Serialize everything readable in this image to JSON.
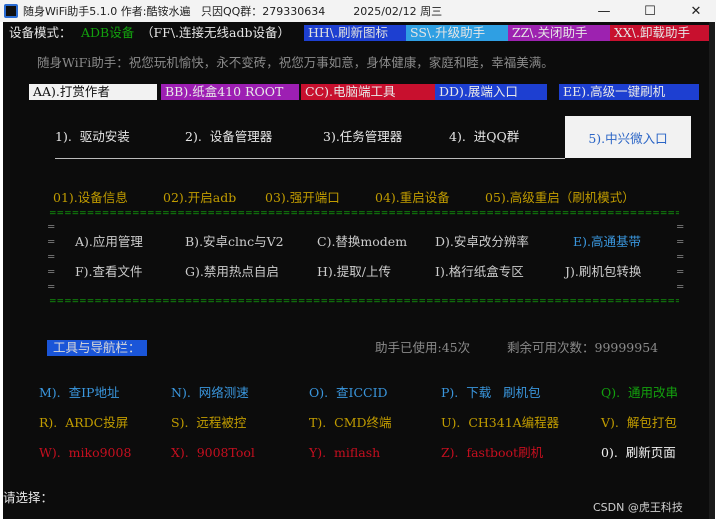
{
  "window": {
    "title": "随身WiFi助手5.1.0 作者:酷铵水遍   只因QQ群：279330634        2025/02/12 周三",
    "minimize_glyph": "—",
    "maximize_glyph": "☐",
    "close_glyph": "✕"
  },
  "header": {
    "device_mode_label": "设备模式：",
    "device_mode_value": "ADB设备",
    "device_mode_hint": "（FF\\.连接无线adb设备）",
    "buttons": [
      {
        "label": "HH\\.刷新图标",
        "bg": "#1d3fd1",
        "fg": "#e0e0e0"
      },
      {
        "label": "SS\\.升级助手",
        "bg": "#2f9fe3",
        "fg": "#e6e6e6"
      },
      {
        "label": "ZZ\\.关闭助手",
        "bg": "#9d22b0",
        "fg": "#e6e6e6"
      },
      {
        "label": "XX\\.卸载助手",
        "bg": "#c8102e",
        "fg": "#e6e6e6"
      }
    ]
  },
  "blessing": "随身WiFi助手：祝您玩机愉快，永不变砖，祝您万事如意，身体健康，家庭和睦，幸福美满。",
  "topbar": [
    {
      "label": "AA).打赏作者",
      "bg": "#f2f2f2",
      "fg": "#111111"
    },
    {
      "label": "BB).纸盒410 ROOT",
      "bg": "#9d1fb3",
      "fg": "#e8e8e8"
    },
    {
      "label": "CC).电脑端工具",
      "bg": "#c8102e",
      "fg": "#e8e8e8"
    },
    {
      "label": "DD).展端入口",
      "bg": "#1d3fd1",
      "fg": "#e8e8e8"
    },
    {
      "label": "EE).高级一键刷机",
      "bg": "#1d3fd1",
      "fg": "#e8e8e8"
    }
  ],
  "tabs": [
    "1).  驱动安装",
    "2).  设备管理器",
    "3).任务管理器",
    "4).  进QQ群",
    "5).中兴微入口"
  ],
  "device_menu": [
    "01).设备信息",
    "02).开启adb",
    "03).强开端口",
    "04).重启设备",
    "05).高级重启（刷机模式）"
  ],
  "grid": {
    "rule_line": "=================================================================================================",
    "edge_char": "=",
    "row1": [
      "A).应用管理",
      "B).安卓clnc与V2",
      "C).替换modem",
      "D).安卓改分辨率",
      "E).高通基带"
    ],
    "row2": [
      "F).查看文件",
      "G).禁用热点自启",
      "H).提取/上传",
      "I).格行纸盒专区",
      "J).刷机包转换"
    ]
  },
  "toolbar": {
    "nav_label": "工具与导航栏：",
    "used_label": "助手已使用:45次",
    "remaining_label": "剩余可用次数：99999954"
  },
  "tools": [
    [
      {
        "label": "M).  查IP地址",
        "color": "#3a96dd"
      },
      {
        "label": "N).  网络测速",
        "color": "#3a96dd"
      },
      {
        "label": "O).  查ICCID",
        "color": "#3a96dd"
      },
      {
        "label": "P).  下载   刷机包",
        "color": "#3a96dd"
      },
      {
        "label": "Q).  通用改串",
        "color": "#13a10e"
      }
    ],
    [
      {
        "label": "R).  ARDC投屏",
        "color": "#c19c00"
      },
      {
        "label": "S).  远程被控",
        "color": "#c19c00"
      },
      {
        "label": "T).  CMD终端",
        "color": "#c19c00"
      },
      {
        "label": "U).  CH341A编程器",
        "color": "#c19c00"
      },
      {
        "label": "V).  解包打包",
        "color": "#c19c00"
      }
    ],
    [
      {
        "label": "W).  miko9008",
        "color": "#c50f1f"
      },
      {
        "label": "X).  9008Tool",
        "color": "#c50f1f"
      },
      {
        "label": "Y).  miflash",
        "color": "#c50f1f"
      },
      {
        "label": "Z).  fastboot刷机",
        "color": "#c50f1f"
      },
      {
        "label": "0).  刷新页面",
        "color": "#f2f2f2"
      }
    ]
  ],
  "prompt": "请选择：",
  "watermark": "CSDN @虎王科技",
  "colors": {
    "console_bg": "#0c0c0c",
    "console_text": "#cccccc",
    "menu_orange": "#c19c00",
    "highlight_blue": "#3a96dd",
    "green": "#13a10e"
  }
}
